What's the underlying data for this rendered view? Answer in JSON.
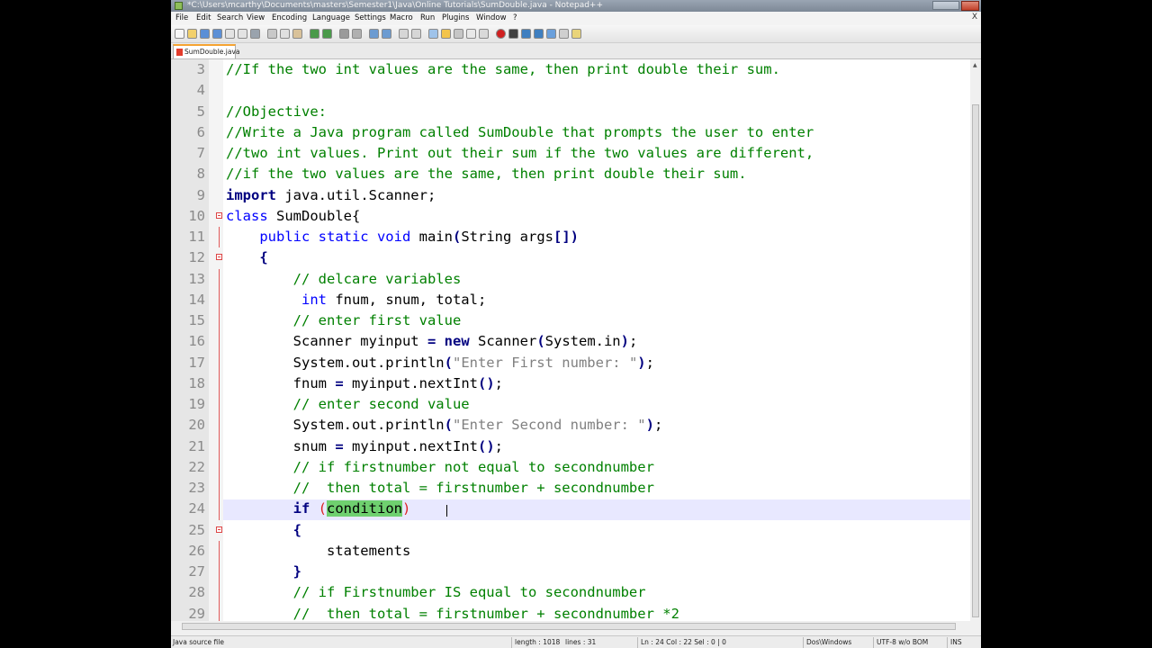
{
  "window": {
    "title": "*C:\\Users\\mcarthy\\Documents\\masters\\Semester1\\Java\\Online Tutorials\\SumDouble.java - Notepad++"
  },
  "menu": {
    "items": [
      "File",
      "Edit",
      "Search",
      "View",
      "Encoding",
      "Language",
      "Settings",
      "Macro",
      "Run",
      "Plugins",
      "Window",
      "?"
    ],
    "close": "X"
  },
  "tab": {
    "label": "SumDouble.java"
  },
  "code_lines": [
    {
      "n": "3",
      "segs": [
        {
          "t": "c",
          "v": "//If the two int values are the same, then print double their sum."
        }
      ]
    },
    {
      "n": "4",
      "segs": []
    },
    {
      "n": "5",
      "segs": [
        {
          "t": "c",
          "v": "//Objective:"
        }
      ]
    },
    {
      "n": "6",
      "segs": [
        {
          "t": "c",
          "v": "//Write a Java program called SumDouble that prompts the user to enter"
        }
      ]
    },
    {
      "n": "7",
      "segs": [
        {
          "t": "c",
          "v": "//two int values. Print out their sum if the two values are different,"
        }
      ]
    },
    {
      "n": "8",
      "segs": [
        {
          "t": "c",
          "v": "//if the two values are the same, then print double their sum."
        }
      ]
    },
    {
      "n": "9",
      "segs": [
        {
          "t": "kb",
          "v": "import"
        },
        {
          "t": "n",
          "v": " java.util.Scanner;"
        }
      ]
    },
    {
      "n": "10",
      "fold": "box",
      "segs": [
        {
          "t": "k",
          "v": "class"
        },
        {
          "t": "n",
          "v": " SumDouble{"
        }
      ]
    },
    {
      "n": "11",
      "fold": "line",
      "segs": [
        {
          "t": "n",
          "v": "    "
        },
        {
          "t": "k",
          "v": "public static void"
        },
        {
          "t": "n",
          "v": " main"
        },
        {
          "t": "o",
          "v": "("
        },
        {
          "t": "n",
          "v": "String args"
        },
        {
          "t": "o",
          "v": "[])"
        }
      ]
    },
    {
      "n": "12",
      "fold": "box",
      "segs": [
        {
          "t": "n",
          "v": "    "
        },
        {
          "t": "o",
          "v": "{"
        }
      ]
    },
    {
      "n": "13",
      "fold": "line",
      "segs": [
        {
          "t": "n",
          "v": "        "
        },
        {
          "t": "c",
          "v": "// delcare variables"
        }
      ]
    },
    {
      "n": "14",
      "fold": "line",
      "segs": [
        {
          "t": "n",
          "v": "         "
        },
        {
          "t": "k",
          "v": "int"
        },
        {
          "t": "n",
          "v": " fnum, snum, total;"
        }
      ]
    },
    {
      "n": "15",
      "fold": "line",
      "segs": [
        {
          "t": "n",
          "v": "        "
        },
        {
          "t": "c",
          "v": "// enter first value"
        }
      ]
    },
    {
      "n": "16",
      "fold": "line",
      "segs": [
        {
          "t": "n",
          "v": "        Scanner myinput "
        },
        {
          "t": "o",
          "v": "="
        },
        {
          "t": "n",
          "v": " "
        },
        {
          "t": "kb",
          "v": "new"
        },
        {
          "t": "n",
          "v": " Scanner"
        },
        {
          "t": "o",
          "v": "("
        },
        {
          "t": "n",
          "v": "System.in"
        },
        {
          "t": "o",
          "v": ")"
        },
        {
          "t": "n",
          "v": ";"
        }
      ]
    },
    {
      "n": "17",
      "fold": "line",
      "segs": [
        {
          "t": "n",
          "v": "        System.out.println"
        },
        {
          "t": "o",
          "v": "("
        },
        {
          "t": "s",
          "v": "\"Enter First number: \""
        },
        {
          "t": "o",
          "v": ")"
        },
        {
          "t": "n",
          "v": ";"
        }
      ]
    },
    {
      "n": "18",
      "fold": "line",
      "segs": [
        {
          "t": "n",
          "v": "        fnum "
        },
        {
          "t": "o",
          "v": "="
        },
        {
          "t": "n",
          "v": " myinput.nextInt"
        },
        {
          "t": "o",
          "v": "()"
        },
        {
          "t": "n",
          "v": ";"
        }
      ]
    },
    {
      "n": "19",
      "fold": "line",
      "segs": [
        {
          "t": "n",
          "v": "        "
        },
        {
          "t": "c",
          "v": "// enter second value"
        }
      ]
    },
    {
      "n": "20",
      "fold": "line",
      "segs": [
        {
          "t": "n",
          "v": "        System.out.println"
        },
        {
          "t": "o",
          "v": "("
        },
        {
          "t": "s",
          "v": "\"Enter Second number: \""
        },
        {
          "t": "o",
          "v": ")"
        },
        {
          "t": "n",
          "v": ";"
        }
      ]
    },
    {
      "n": "21",
      "fold": "line",
      "segs": [
        {
          "t": "n",
          "v": "        snum "
        },
        {
          "t": "o",
          "v": "="
        },
        {
          "t": "n",
          "v": " myinput.nextInt"
        },
        {
          "t": "o",
          "v": "()"
        },
        {
          "t": "n",
          "v": ";"
        }
      ]
    },
    {
      "n": "22",
      "fold": "line",
      "segs": [
        {
          "t": "n",
          "v": "        "
        },
        {
          "t": "c",
          "v": "// if firstnumber not equal to secondnumber"
        }
      ]
    },
    {
      "n": "23",
      "fold": "line",
      "segs": [
        {
          "t": "n",
          "v": "        "
        },
        {
          "t": "c",
          "v": "//  then total = firstnumber + secondnumber"
        }
      ]
    },
    {
      "n": "24",
      "fold": "line",
      "current": true,
      "segs": [
        {
          "t": "n",
          "v": "        "
        },
        {
          "t": "kb",
          "v": "if"
        },
        {
          "t": "n",
          "v": " "
        },
        {
          "t": "p",
          "v": "("
        },
        {
          "t": "hl",
          "v": "condition"
        },
        {
          "t": "p",
          "v": ")"
        }
      ]
    },
    {
      "n": "25",
      "fold": "box",
      "segs": [
        {
          "t": "n",
          "v": "        "
        },
        {
          "t": "o",
          "v": "{"
        }
      ]
    },
    {
      "n": "26",
      "fold": "line",
      "segs": [
        {
          "t": "n",
          "v": "            statements"
        }
      ]
    },
    {
      "n": "27",
      "fold": "line",
      "segs": [
        {
          "t": "n",
          "v": "        "
        },
        {
          "t": "o",
          "v": "}"
        }
      ]
    },
    {
      "n": "28",
      "fold": "line",
      "segs": [
        {
          "t": "n",
          "v": "        "
        },
        {
          "t": "c",
          "v": "// if Firstnumber IS equal to secondnumber"
        }
      ]
    },
    {
      "n": "29",
      "fold": "line",
      "segs": [
        {
          "t": "n",
          "v": "        "
        },
        {
          "t": "c",
          "v": "//  then total = firstnumber + secondnumber *2"
        }
      ]
    }
  ],
  "status": {
    "file_type": "Java source file",
    "length": "length : 1018",
    "lines": "lines : 31",
    "position": "Ln : 24    Col : 22    Sel : 0 | 0",
    "eol": "Dos\\Windows",
    "encoding": "UTF-8 w/o BOM",
    "mode": "INS"
  },
  "toolbar_icons": [
    "new-icon",
    "open-icon",
    "save-icon",
    "save-all-icon",
    "close-icon",
    "close-all-icon",
    "print-icon",
    "cut-icon",
    "copy-icon",
    "paste-icon",
    "undo-icon",
    "redo-icon",
    "find-icon",
    "replace-icon",
    "zoom-in-icon",
    "zoom-out-icon",
    "sync-v-icon",
    "sync-h-icon",
    "wrap-icon",
    "all-chars-icon",
    "indent-guide-icon",
    "lang-icon",
    "doc-map-icon",
    "record-macro-icon",
    "stop-macro-icon",
    "play-macro-icon",
    "play-multi-icon",
    "save-macro-icon",
    "trim-icon",
    "run-icon"
  ]
}
